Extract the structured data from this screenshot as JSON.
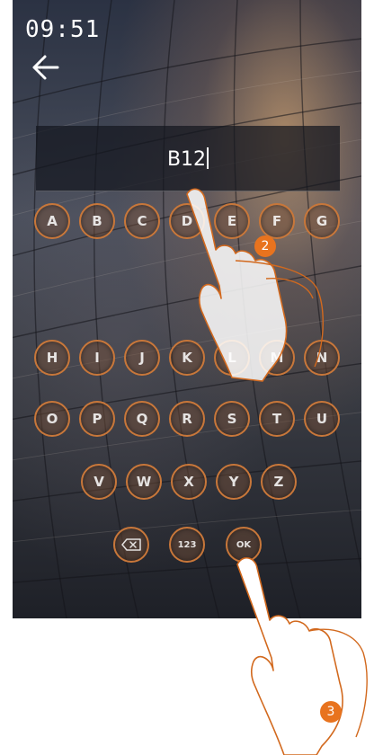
{
  "status_bar": {
    "time": "09:51"
  },
  "input": {
    "value": "B12"
  },
  "keyboard": {
    "rows": [
      [
        "A",
        "B",
        "C",
        "D",
        "E",
        "F",
        "G"
      ],
      [
        "H",
        "I",
        "J",
        "K",
        "L",
        "M",
        "N"
      ],
      [
        "O",
        "P",
        "Q",
        "R",
        "S",
        "T",
        "U"
      ],
      [
        "V",
        "W",
        "X",
        "Y",
        "Z"
      ]
    ],
    "number_key_label": "123",
    "ok_key_label": "OK"
  },
  "annotations": {
    "step_2": "2",
    "step_3": "3"
  },
  "colors": {
    "key_border": "#c8773a",
    "badge": "#e8731e"
  }
}
